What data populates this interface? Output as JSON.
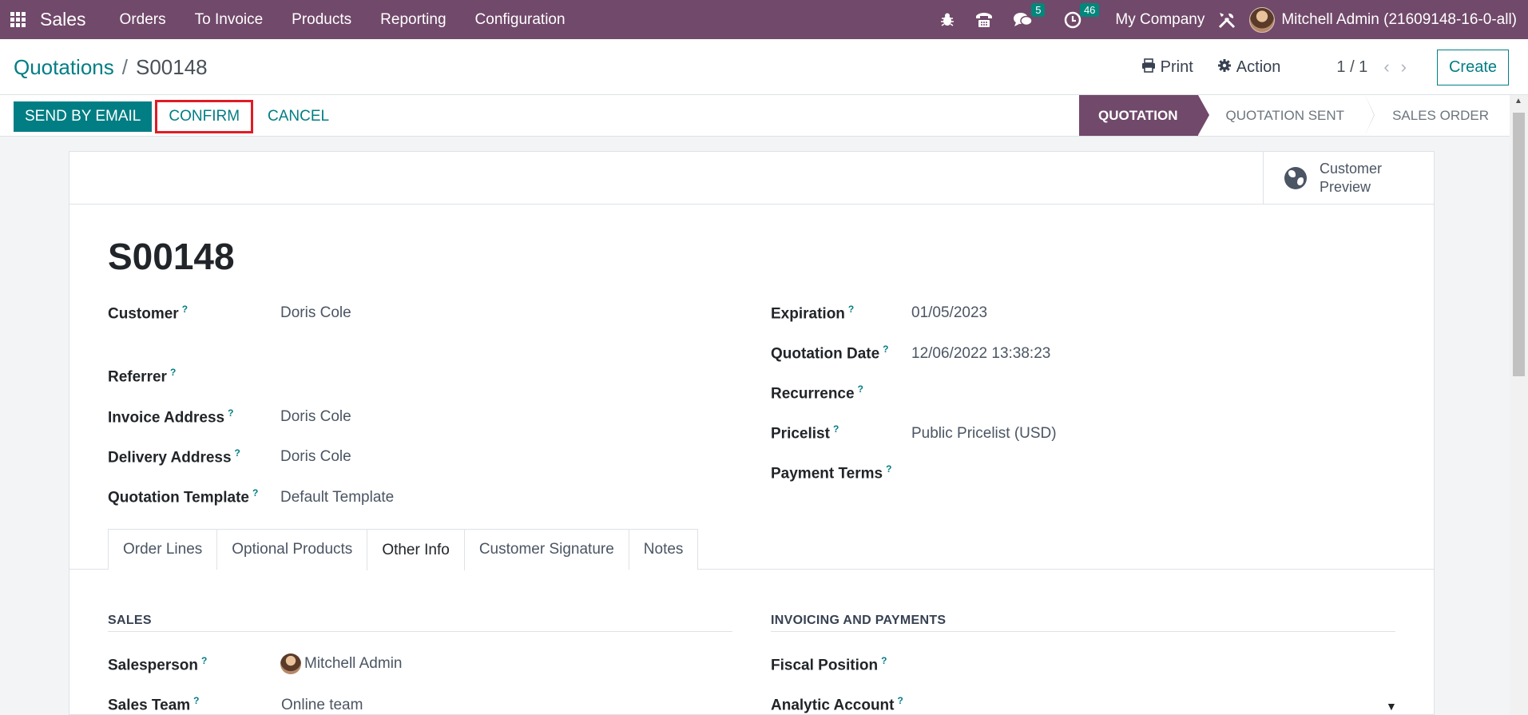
{
  "navbar": {
    "app_name": "Sales",
    "menu": [
      "Orders",
      "To Invoice",
      "Products",
      "Reporting",
      "Configuration"
    ],
    "messages_count": "5",
    "activities_count": "46",
    "company": "My Company",
    "user": "Mitchell Admin (21609148-16-0-all)"
  },
  "control_panel": {
    "breadcrumb_parent": "Quotations",
    "breadcrumb_sep": "/",
    "breadcrumb_current": "S00148",
    "print_label": "Print",
    "action_label": "Action",
    "pager": "1 / 1",
    "create_label": "Create"
  },
  "statusbar": {
    "send_by_email": "SEND BY EMAIL",
    "confirm": "CONFIRM",
    "cancel": "CANCEL",
    "stages": [
      "QUOTATION",
      "QUOTATION SENT",
      "SALES ORDER"
    ],
    "active_stage": "QUOTATION"
  },
  "sheet": {
    "customer_preview_line1": "Customer",
    "customer_preview_line2": "Preview",
    "title": "S00148",
    "help_mark": "?",
    "left_fields": [
      {
        "label": "Customer",
        "value": "Doris Cole"
      },
      {
        "label": "Referrer",
        "value": ""
      },
      {
        "label": "Invoice Address",
        "value": "Doris Cole"
      },
      {
        "label": "Delivery Address",
        "value": "Doris Cole"
      },
      {
        "label": "Quotation Template",
        "value": "Default Template"
      }
    ],
    "right_fields": [
      {
        "label": "Expiration",
        "value": "01/05/2023"
      },
      {
        "label": "Quotation Date",
        "value": "12/06/2022 13:38:23"
      },
      {
        "label": "Recurrence",
        "value": ""
      },
      {
        "label": "Pricelist",
        "value": "Public Pricelist (USD)"
      },
      {
        "label": "Payment Terms",
        "value": ""
      }
    ],
    "tabs": [
      "Order Lines",
      "Optional Products",
      "Other Info",
      "Customer Signature",
      "Notes"
    ],
    "active_tab": "Other Info",
    "sales_section": {
      "title": "SALES",
      "fields": [
        {
          "label": "Salesperson",
          "value": "Mitchell Admin"
        },
        {
          "label": "Sales Team",
          "value": "Online team"
        }
      ]
    },
    "invoicing_section": {
      "title": "INVOICING AND PAYMENTS",
      "fields": [
        {
          "label": "Fiscal Position",
          "value": ""
        },
        {
          "label": "Analytic Account",
          "value": ""
        }
      ]
    }
  },
  "icons": {
    "apps": "apps-grid-icon",
    "bug": "bug-icon",
    "phone": "phone-icon",
    "chat": "chat-icon",
    "clock": "clock-icon",
    "tools": "tools-icon",
    "print": "print-icon",
    "gear": "gear-icon",
    "globe": "globe-icon"
  },
  "colors": {
    "navbar": "#71496a",
    "primary": "#017e84",
    "confirm_highlight": "#e01b24"
  }
}
